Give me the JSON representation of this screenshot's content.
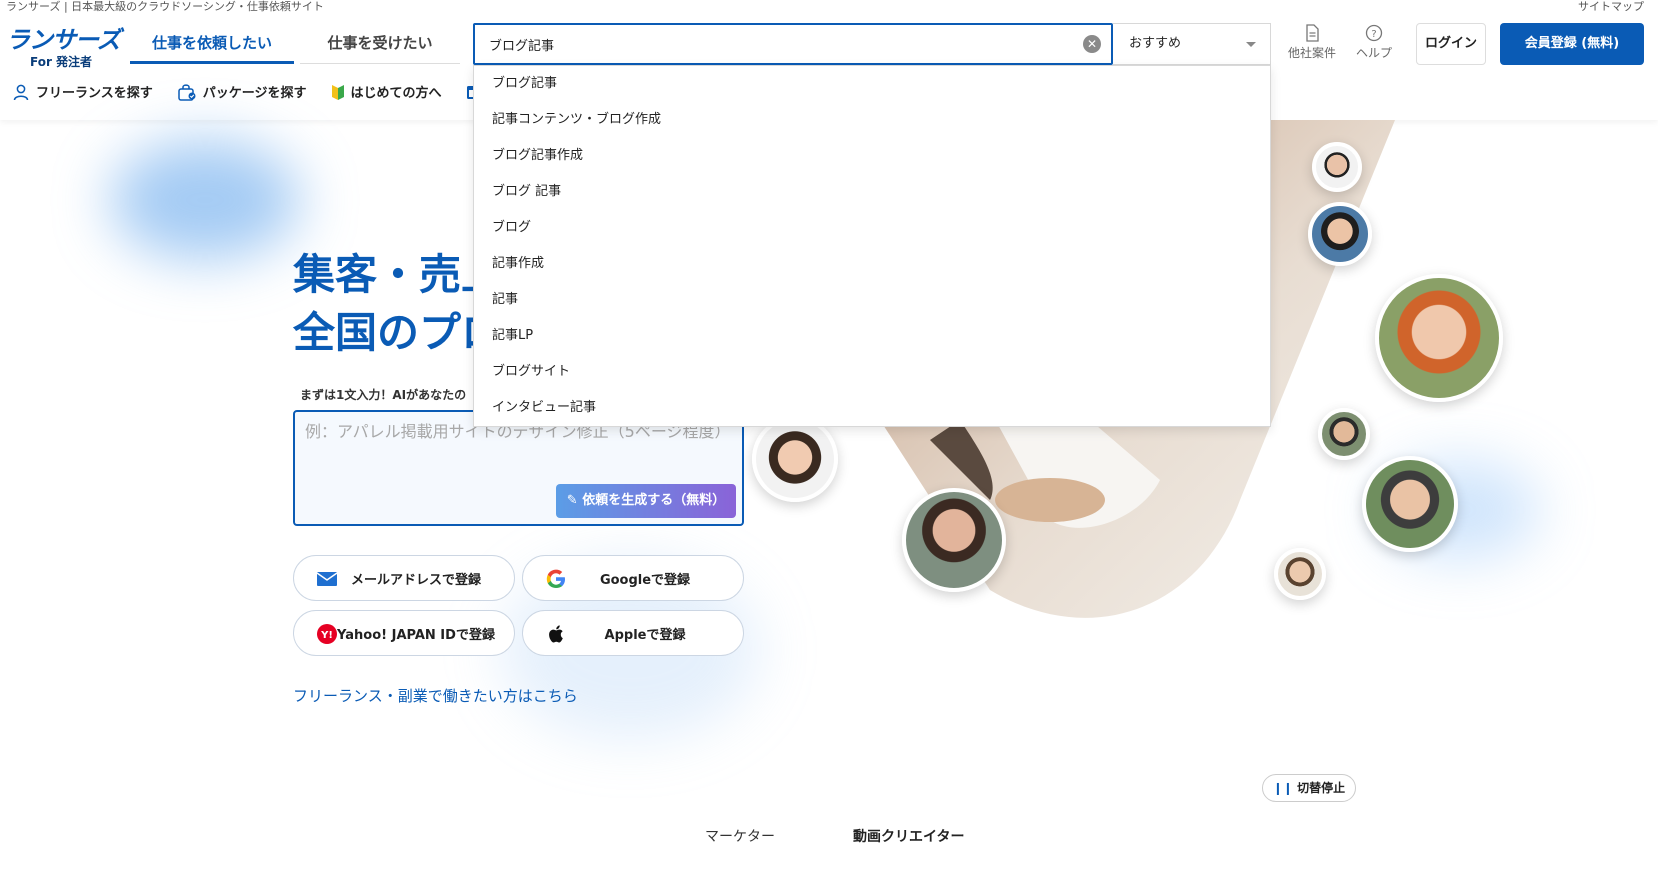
{
  "top": {
    "tagline": "ランサーズ | 日本最大級のクラウドソーシング・仕事依頼サイト",
    "sitemap": "サイトマップ"
  },
  "header": {
    "logo_main": "ランサーズ",
    "logo_sub": "For 発注者",
    "tab_active": "仕事を依頼したい",
    "tab_inactive": "仕事を受けたい",
    "search_value": "ブログ記事",
    "sort_label": "おすすめ",
    "other_projects": "他社案件",
    "help": "ヘルプ",
    "login": "ログイン",
    "register": "会員登録 (無料)"
  },
  "subnav": {
    "items": [
      "フリーランスを探す",
      "パッケージを探す",
      "はじめての方へ"
    ]
  },
  "dropdown": {
    "suggestions": [
      "ブログ記事",
      "記事コンテンツ・ブログ作成",
      "ブログ記事作成",
      "ブログ 記事",
      "ブログ",
      "記事作成",
      "記事",
      "記事LP",
      "ブログサイト",
      "インタビュー記事"
    ]
  },
  "hero": {
    "title_line1": "集客・売上",
    "title_line2": "全国のプロ",
    "prompt_label": "まずは1文入力！AIがあなたの",
    "ai_placeholder": "例：アパレル掲載用サイトのデザイン修正（5ページ程度）",
    "ai_generate": "依頼を生成する（無料）",
    "signup_email": "メールアドレスで登録",
    "signup_google": "Googleで登録",
    "signup_yahoo": "Yahoo! JAPAN IDで登録",
    "signup_apple": "Appleで登録",
    "freelance_link": "フリーランス・副業で働きたい方はこちら"
  },
  "carousel": {
    "pause": "切替停止",
    "tabs": [
      "マーケター",
      "動画クリエイター"
    ]
  },
  "colors": {
    "brand": "#0a5bb5",
    "gradient_start": "#5b9de6",
    "gradient_end": "#8a63d8"
  }
}
